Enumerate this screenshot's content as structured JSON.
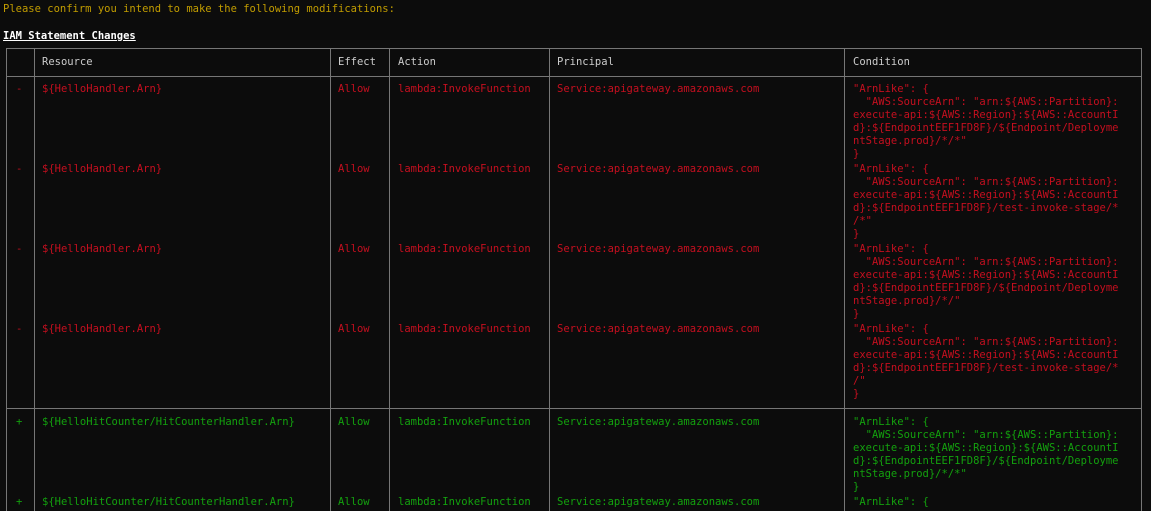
{
  "confirm_text": "Please confirm you intend to make the following modifications:",
  "section_title": "IAM Statement Changes",
  "table": {
    "headers": {
      "resource": "Resource",
      "effect": "Effect",
      "action": "Action",
      "principal": "Principal",
      "condition": "Condition"
    },
    "rows": [
      {
        "sign": "-",
        "status": "removed",
        "resource": "${HelloHandler.Arn}",
        "effect": "Allow",
        "action": "lambda:InvokeFunction",
        "principal": "Service:apigateway.amazonaws.com",
        "condition": "\"ArnLike\": {\n  \"AWS:SourceArn\": \"arn:${AWS::Partition}:\nexecute-api:${AWS::Region}:${AWS::AccountI\nd}:${EndpointEEF1FD8F}/${Endpoint/Deployme\nntStage.prod}/*/*\"\n}"
      },
      {
        "sign": "-",
        "status": "removed",
        "resource": "${HelloHandler.Arn}",
        "effect": "Allow",
        "action": "lambda:InvokeFunction",
        "principal": "Service:apigateway.amazonaws.com",
        "condition": "\"ArnLike\": {\n  \"AWS:SourceArn\": \"arn:${AWS::Partition}:\nexecute-api:${AWS::Region}:${AWS::AccountI\nd}:${EndpointEEF1FD8F}/test-invoke-stage/*\n/*\"\n}"
      },
      {
        "sign": "-",
        "status": "removed",
        "resource": "${HelloHandler.Arn}",
        "effect": "Allow",
        "action": "lambda:InvokeFunction",
        "principal": "Service:apigateway.amazonaws.com",
        "condition": "\"ArnLike\": {\n  \"AWS:SourceArn\": \"arn:${AWS::Partition}:\nexecute-api:${AWS::Region}:${AWS::AccountI\nd}:${EndpointEEF1FD8F}/${Endpoint/Deployme\nntStage.prod}/*/\"\n}"
      },
      {
        "sign": "-",
        "status": "removed",
        "resource": "${HelloHandler.Arn}",
        "effect": "Allow",
        "action": "lambda:InvokeFunction",
        "principal": "Service:apigateway.amazonaws.com",
        "condition": "\"ArnLike\": {\n  \"AWS:SourceArn\": \"arn:${AWS::Partition}:\nexecute-api:${AWS::Region}:${AWS::AccountI\nd}:${EndpointEEF1FD8F}/test-invoke-stage/*\n/\"\n}"
      },
      {
        "sign": "+",
        "status": "added",
        "resource": "${HelloHitCounter/HitCounterHandler.Arn}",
        "effect": "Allow",
        "action": "lambda:InvokeFunction",
        "principal": "Service:apigateway.amazonaws.com",
        "condition": "\"ArnLike\": {\n  \"AWS:SourceArn\": \"arn:${AWS::Partition}:\nexecute-api:${AWS::Region}:${AWS::AccountI\nd}:${EndpointEEF1FD8F}/${Endpoint/Deployme\nntStage.prod}/*/*\"\n}"
      },
      {
        "sign": "+",
        "status": "added",
        "resource": "${HelloHitCounter/HitCounterHandler.Arn}",
        "effect": "Allow",
        "action": "lambda:InvokeFunction",
        "principal": "Service:apigateway.amazonaws.com",
        "condition": "\"ArnLike\": {"
      }
    ]
  },
  "colors": {
    "removed": "#c50f1f",
    "added": "#13a10e",
    "prompt": "#c19c00",
    "border": "#767676",
    "background": "#0c0c0c"
  }
}
